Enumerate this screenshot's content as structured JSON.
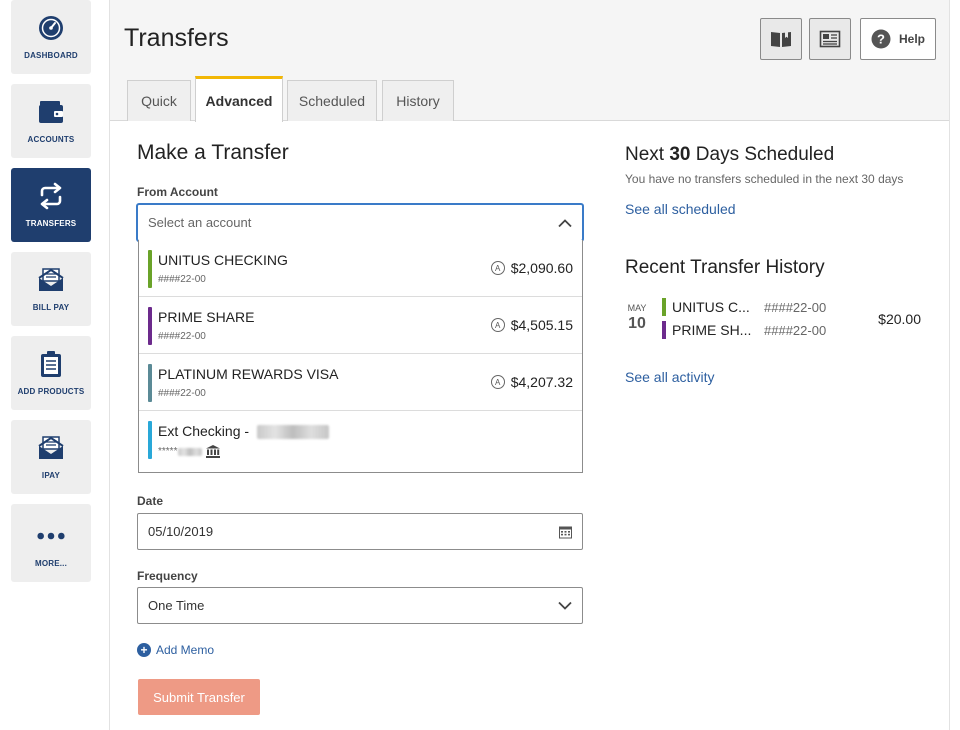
{
  "sidebar": {
    "items": [
      {
        "label": "DASHBOARD",
        "icon": "gauge-icon"
      },
      {
        "label": "ACCOUNTS",
        "icon": "wallet-icon"
      },
      {
        "label": "TRANSFERS",
        "icon": "transfer-arrows-icon"
      },
      {
        "label": "BILL PAY",
        "icon": "envelope-icon"
      },
      {
        "label": "ADD PRODUCTS",
        "icon": "clipboard-icon"
      },
      {
        "label": "IPAY",
        "icon": "envelope-icon"
      },
      {
        "label": "MORE...",
        "icon": "more-dots-icon"
      }
    ],
    "active_index": 2
  },
  "header": {
    "title": "Transfers",
    "help_label": "Help",
    "tabs": [
      {
        "label": "Quick"
      },
      {
        "label": "Advanced"
      },
      {
        "label": "Scheduled"
      },
      {
        "label": "History"
      }
    ],
    "active_tab": 1
  },
  "form": {
    "title": "Make a Transfer",
    "from_label": "From Account",
    "from_placeholder": "Select an account",
    "accounts": [
      {
        "name": "UNITUS CHECKING",
        "number": "####22-00",
        "balance": "$2,090.60",
        "color": "#6aa329"
      },
      {
        "name": "PRIME SHARE",
        "number": "####22-00",
        "balance": "$4,505.15",
        "color": "#6c2a8c"
      },
      {
        "name": "PLATINUM REWARDS VISA",
        "number": "####22-00",
        "balance": "$4,207.32",
        "color": "#5b8a96"
      },
      {
        "name": "Ext Checking - ",
        "number": "*****",
        "balance": "",
        "color": "#29a8d8"
      }
    ],
    "date_label": "Date",
    "date_value": "05/10/2019",
    "frequency_label": "Frequency",
    "frequency_value": "One Time",
    "memo_label": "Add Memo",
    "submit_label": "Submit Transfer"
  },
  "scheduled": {
    "title_prefix": "Next ",
    "title_bold": "30",
    "title_suffix": " Days Scheduled",
    "empty_text": "You have no transfers scheduled in the next 30 days",
    "link": "See all scheduled"
  },
  "history": {
    "title": "Recent Transfer History",
    "month": "MAY",
    "day": "10",
    "from": {
      "name": "UNITUS C...",
      "number": "####22-00",
      "color": "#6aa329"
    },
    "to": {
      "name": "PRIME SH...",
      "number": "####22-00",
      "color": "#6c2a8c"
    },
    "amount": "$20.00",
    "link": "See all activity"
  }
}
